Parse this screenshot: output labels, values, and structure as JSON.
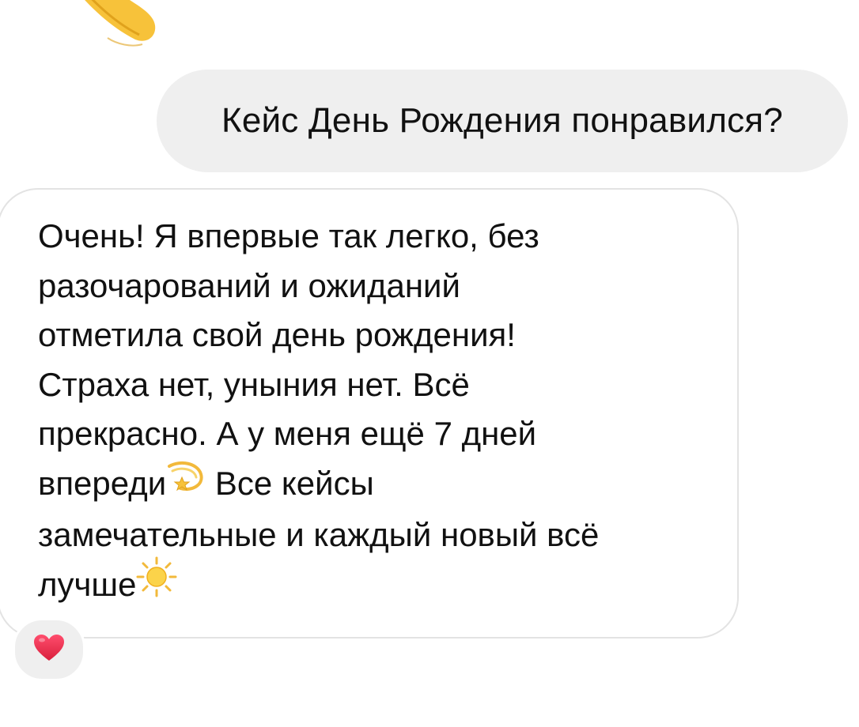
{
  "messages": {
    "outgoing": {
      "text": "Кейс День Рождения понравился?"
    },
    "incoming": {
      "lines": [
        "Очень! Я впервые так легко, без",
        "разочарований и ожиданий",
        "отметила свой день рождения!",
        "Страха нет, уныния нет. Всё",
        "прекрасно. А у меня ещё 7 дней"
      ],
      "line6_before": "впереди",
      "line6_after": " Все кейсы",
      "line7": "замечательные и каждый новый всё",
      "line8": "лучше",
      "emoji_1": "dizzy-icon",
      "emoji_2": "sun-icon"
    },
    "reaction": {
      "icon": "heart-icon",
      "color": "#e0245e"
    },
    "top_emoji": "waving-hand-icon"
  },
  "colors": {
    "outgoing_bubble": "#efefef",
    "incoming_border": "#e3e3e3",
    "text": "#111111",
    "emoji_yellow": "#f7c23a"
  }
}
